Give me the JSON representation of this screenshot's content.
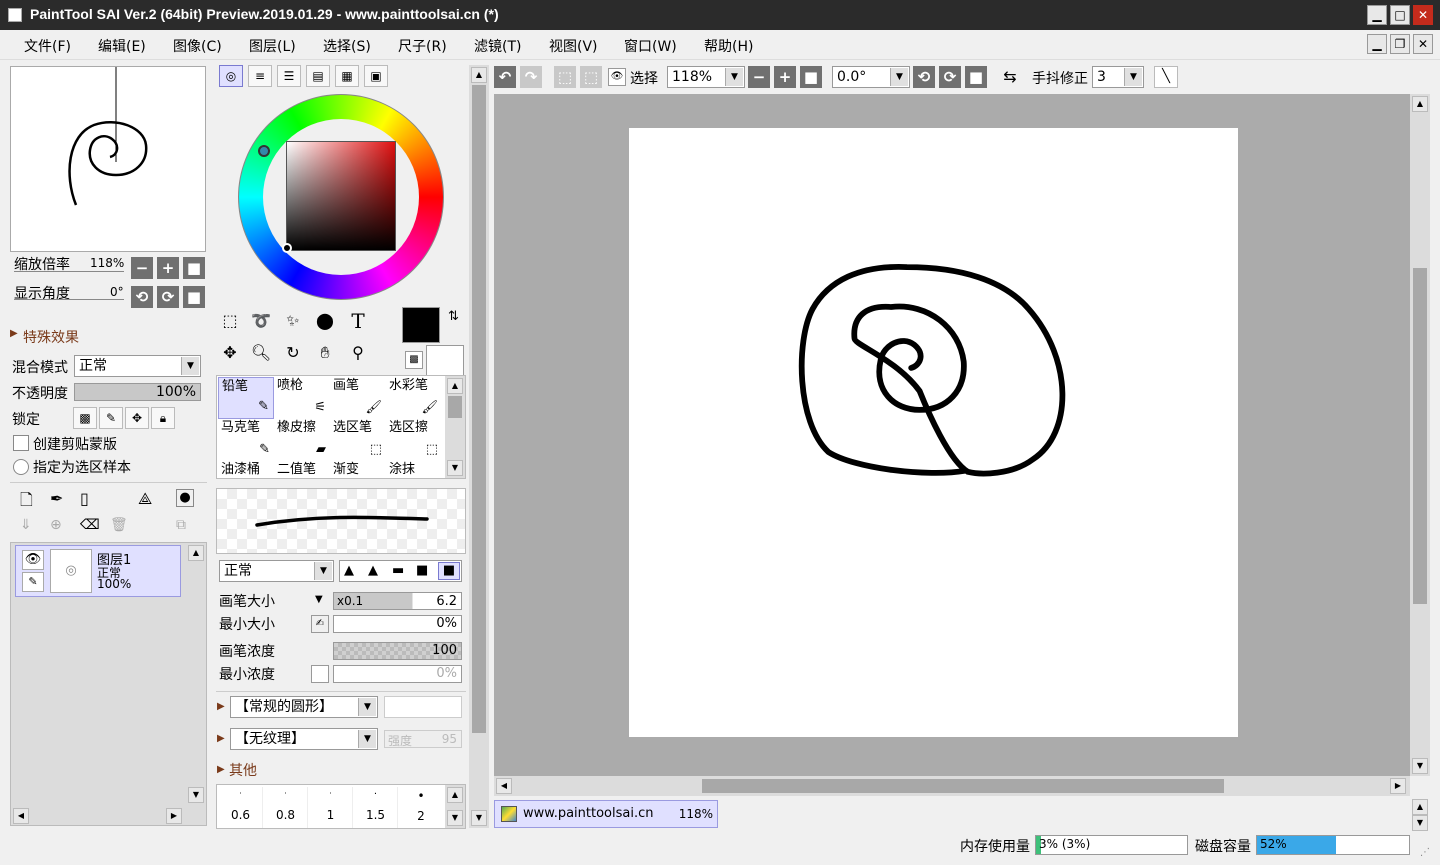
{
  "titlebar": {
    "title": "PaintTool SAI Ver.2 (64bit) Preview.2019.01.29 - www.painttoolsai.cn (*)",
    "min": "▁",
    "max": "□",
    "close": "✕"
  },
  "menubar": {
    "items": [
      "文件(F)",
      "编辑(E)",
      "图像(C)",
      "图层(L)",
      "选择(S)",
      "尺子(R)",
      "滤镜(T)",
      "视图(V)",
      "窗口(W)",
      "帮助(H)"
    ]
  },
  "navigator": {
    "zoom_label": "缩放倍率",
    "zoom_value": "118%",
    "angle_label": "显示角度",
    "angle_value": "0°"
  },
  "layer_panel": {
    "effects_label": "特殊效果",
    "blend_label": "混合模式",
    "blend_value": "正常",
    "opacity_label": "不透明度",
    "opacity_value": "100%",
    "lock_label": "锁定",
    "clip_label": "创建剪贴蒙版",
    "sample_label": "指定为选区样本",
    "layers": [
      {
        "name": "图层1",
        "mode": "正常",
        "opacity": "100%"
      }
    ]
  },
  "color": {
    "current": "#000000",
    "secondary": "#ffffff"
  },
  "brushes": {
    "items": [
      "铅笔",
      "喷枪",
      "画笔",
      "水彩笔",
      "马克笔",
      "橡皮擦",
      "选区笔",
      "选区擦",
      "油漆桶",
      "二值笔",
      "渐变",
      "涂抹"
    ]
  },
  "brush_settings": {
    "mode": "正常",
    "size_label": "画笔大小",
    "size_mult": "x0.1",
    "size_value": "6.2",
    "min_size_label": "最小大小",
    "min_size_value": "0%",
    "density_label": "画笔浓度",
    "density_value": "100",
    "min_density_label": "最小浓度",
    "min_density_value": "0%",
    "shape": "【常规的圆形】",
    "texture": "【无纹理】",
    "strength_label": "强度",
    "strength_value": "95",
    "other_label": "其他",
    "dot_sizes": [
      "0.6",
      "0.8",
      "1",
      "1.5",
      "2"
    ]
  },
  "toolbar": {
    "select_label": "选择",
    "zoom": "118%",
    "angle": "0.0°",
    "stabilizer_label": "手抖修正",
    "stabilizer_value": "3"
  },
  "canvas_tab": {
    "name": "www.painttoolsai.cn",
    "zoom": "118%"
  },
  "status": {
    "memory_label": "内存使用量",
    "memory_value": "3% (3%)",
    "memory_fraction": 0.03,
    "disk_label": "磁盘容量",
    "disk_value": "52%",
    "disk_fraction": 0.52
  }
}
